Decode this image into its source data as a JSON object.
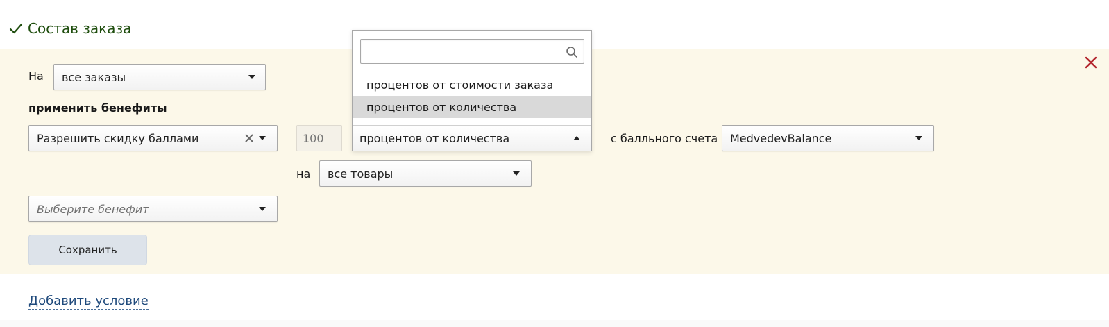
{
  "section": {
    "title": "Состав заказа"
  },
  "condition": {
    "on_label": "На",
    "order_select_value": "все заказы",
    "apply_benefits_label": "применить бенефиты",
    "benefit_select_value": "Разрешить скидку баллами",
    "amount_placeholder": "100",
    "unit_select_value": "процентов от количества",
    "account_label": "с балльного счета",
    "account_select_value": "MedvedevBalance",
    "goods_label": "на",
    "goods_select_value": "все товары",
    "new_benefit_placeholder": "Выберите бенефит",
    "save_label": "Сохранить"
  },
  "dropdown": {
    "search_value": "",
    "options": [
      {
        "label": "процентов от стоимости заказа",
        "selected": false
      },
      {
        "label": "процентов от количества",
        "selected": true
      }
    ]
  },
  "footer": {
    "add_condition_label": "Добавить условие"
  },
  "colors": {
    "panel_background": "#fcf8e9",
    "title_green": "#1e4d0d",
    "link_blue": "#1f4a7c",
    "close_red": "#b3262d",
    "button_background": "#dde3ea"
  },
  "icons": [
    "check-icon",
    "close-icon",
    "search-icon",
    "clear-icon",
    "chevron-down-icon",
    "chevron-up-icon"
  ]
}
